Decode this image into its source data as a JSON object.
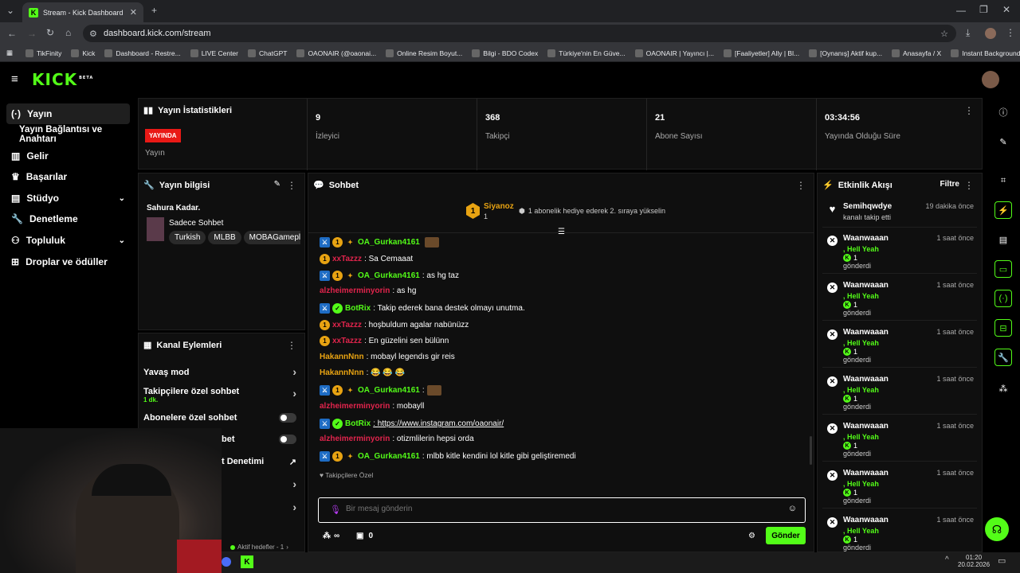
{
  "browser": {
    "tab_title": "Stream - Kick Dashboard",
    "url": "dashboard.kick.com/stream",
    "bookmarks": [
      "TikFinity",
      "Kick",
      "Dashboard - Restre...",
      "LIVE Center",
      "ChatGPT",
      "OAONAIR (@oaonai...",
      "Online Resim Boyut...",
      "Bilgi - BDO Codex",
      "Türkiye'nin En Güve...",
      "OAONAIR | Yayıncı |...",
      "[Faaliyetler] Ally | Bl...",
      "[Oynanış] Aktif kup...",
      "Anasayfa / X",
      "Instant Background..."
    ]
  },
  "sidebar": {
    "items": [
      {
        "label": "Yayın",
        "icon": "broadcast-icon"
      },
      {
        "label": "Yayın Bağlantısı ve Anahtarı"
      },
      {
        "label": "Gelir",
        "icon": "revenue-icon"
      },
      {
        "label": "Başarılar",
        "icon": "trophy-icon"
      },
      {
        "label": "Stüdyo",
        "icon": "studio-icon"
      },
      {
        "label": "Denetleme",
        "icon": "wrench-icon"
      },
      {
        "label": "Topluluk",
        "icon": "community-icon"
      },
      {
        "label": "Droplar ve ödüller",
        "icon": "gift-icon"
      }
    ]
  },
  "stats": {
    "title": "Yayın İstatistikleri",
    "live_badge": "YAYINDA",
    "live_label": "Yayın",
    "viewers": "9",
    "viewers_label": "İzleyici",
    "followers": "368",
    "followers_label": "Takipçi",
    "subs": "21",
    "subs_label": "Abone Sayısı",
    "uptime": "03:34:56",
    "uptime_label": "Yayında Olduğu Süre"
  },
  "stream_info": {
    "title": "Yayın bilgisi",
    "stream_title": "Sahura Kadar.",
    "category": "Sadece Sohbet",
    "tags": [
      "Turkish",
      "MLBB",
      "MOBAGamepla"
    ]
  },
  "channel_actions": {
    "title": "Kanal Eylemleri",
    "slow_mode": "Yavaş mod",
    "followers_chat": "Takipçilere özel sohbet",
    "followers_chat_sub": "1 dk.",
    "subs_chat": "Abonelere özel sohbet",
    "emote_chat": "bet",
    "moderation": "t Denetimi",
    "goals": "Aktif hedefler - 1"
  },
  "chat": {
    "title": "Sohbet",
    "gift_leader": "Siyanoz",
    "gift_count": "1",
    "gift_hint": "1 abonelik hediye ederek 2. sıraya yükselin",
    "messages": [
      {
        "user": "OA_Gurkan4161",
        "text": "",
        "cls": "u-green",
        "badges": "mod"
      },
      {
        "user": "xxTazzz",
        "text": ": Sa Cemaaat",
        "cls": "u-red",
        "badges": "sub"
      },
      {
        "user": "OA_Gurkan4161",
        "text": ": as hg taz",
        "cls": "u-green",
        "badges": "mod"
      },
      {
        "user": "alzheimerminyorin",
        "text": ": as hg",
        "cls": "u-red",
        "badges": ""
      },
      {
        "user": "BotRix",
        "text": ": Takip ederek bana destek olmayı unutma.",
        "cls": "u-green",
        "badges": "bot"
      },
      {
        "user": "xxTazzz",
        "text": ": hoşbuldum agalar nabünüzz",
        "cls": "u-red",
        "badges": "sub"
      },
      {
        "user": "xxTazzz",
        "text": ": En güzelini sen bülünn",
        "cls": "u-red",
        "badges": "sub"
      },
      {
        "user": "HakannNnn",
        "text": ": mobayl legendıs gir reis",
        "cls": "u-gold",
        "badges": ""
      },
      {
        "user": "HakannNnn",
        "text": ": 😂 😂 😂",
        "cls": "u-gold",
        "badges": ""
      },
      {
        "user": "OA_Gurkan4161",
        "text": ":",
        "cls": "u-green",
        "badges": "mod"
      },
      {
        "user": "alzheimerminyorin",
        "text": ": mobayll",
        "cls": "u-red",
        "badges": ""
      },
      {
        "user": "BotRix",
        "text": ": https://www.instagram.com/oaonair/",
        "cls": "u-green",
        "badges": "bot"
      },
      {
        "user": "alzheimerminyorin",
        "text": ": otizmlilerin hepsi orda",
        "cls": "u-red",
        "badges": ""
      },
      {
        "user": "OA_Gurkan4161",
        "text": ": mlbb kitle kendini lol kitle gibi geliştiremedi",
        "cls": "u-green",
        "badges": "mod"
      }
    ],
    "followers_only": "Takipçilere Özel",
    "input_placeholder": "Bir mesaj gönderin",
    "points": "∞",
    "store_count": "0",
    "send_label": "Gönder"
  },
  "activity": {
    "title": "Etkinlik Akışı",
    "filter": "Filtre",
    "follow_item": {
      "user": "Semihqwdye",
      "time": "19 dakika önce",
      "text": "kanalı takip etti"
    },
    "items": [
      {
        "user": "Waanwaaan",
        "time": "1 saat önce",
        "reward": ", Hell Yeah",
        "count": "1",
        "sent": "gönderdi"
      },
      {
        "user": "Waanwaaan",
        "time": "1 saat önce",
        "reward": ", Hell Yeah",
        "count": "1",
        "sent": "gönderdi"
      },
      {
        "user": "Waanwaaan",
        "time": "1 saat önce",
        "reward": ", Hell Yeah",
        "count": "1",
        "sent": "gönderdi"
      },
      {
        "user": "Waanwaaan",
        "time": "1 saat önce",
        "reward": ", Hell Yeah",
        "count": "1",
        "sent": "gönderdi"
      },
      {
        "user": "Waanwaaan",
        "time": "1 saat önce",
        "reward": ", Hell Yeah",
        "count": "1",
        "sent": "gönderdi"
      },
      {
        "user": "Waanwaaan",
        "time": "1 saat önce",
        "reward": ", Hell Yeah",
        "count": "1",
        "sent": "gönderdi"
      },
      {
        "user": "Waanwaaan",
        "time": "1 saat önce",
        "reward": ", Hell Yeah",
        "count": "1",
        "sent": "gönderdi"
      }
    ]
  },
  "taskbar": {
    "time": "01:20",
    "date": "20.02.2026"
  },
  "colors": {
    "brand": "#53fc18",
    "live": "#e91916",
    "bg": "#000000",
    "panel": "#0f0f0f"
  }
}
